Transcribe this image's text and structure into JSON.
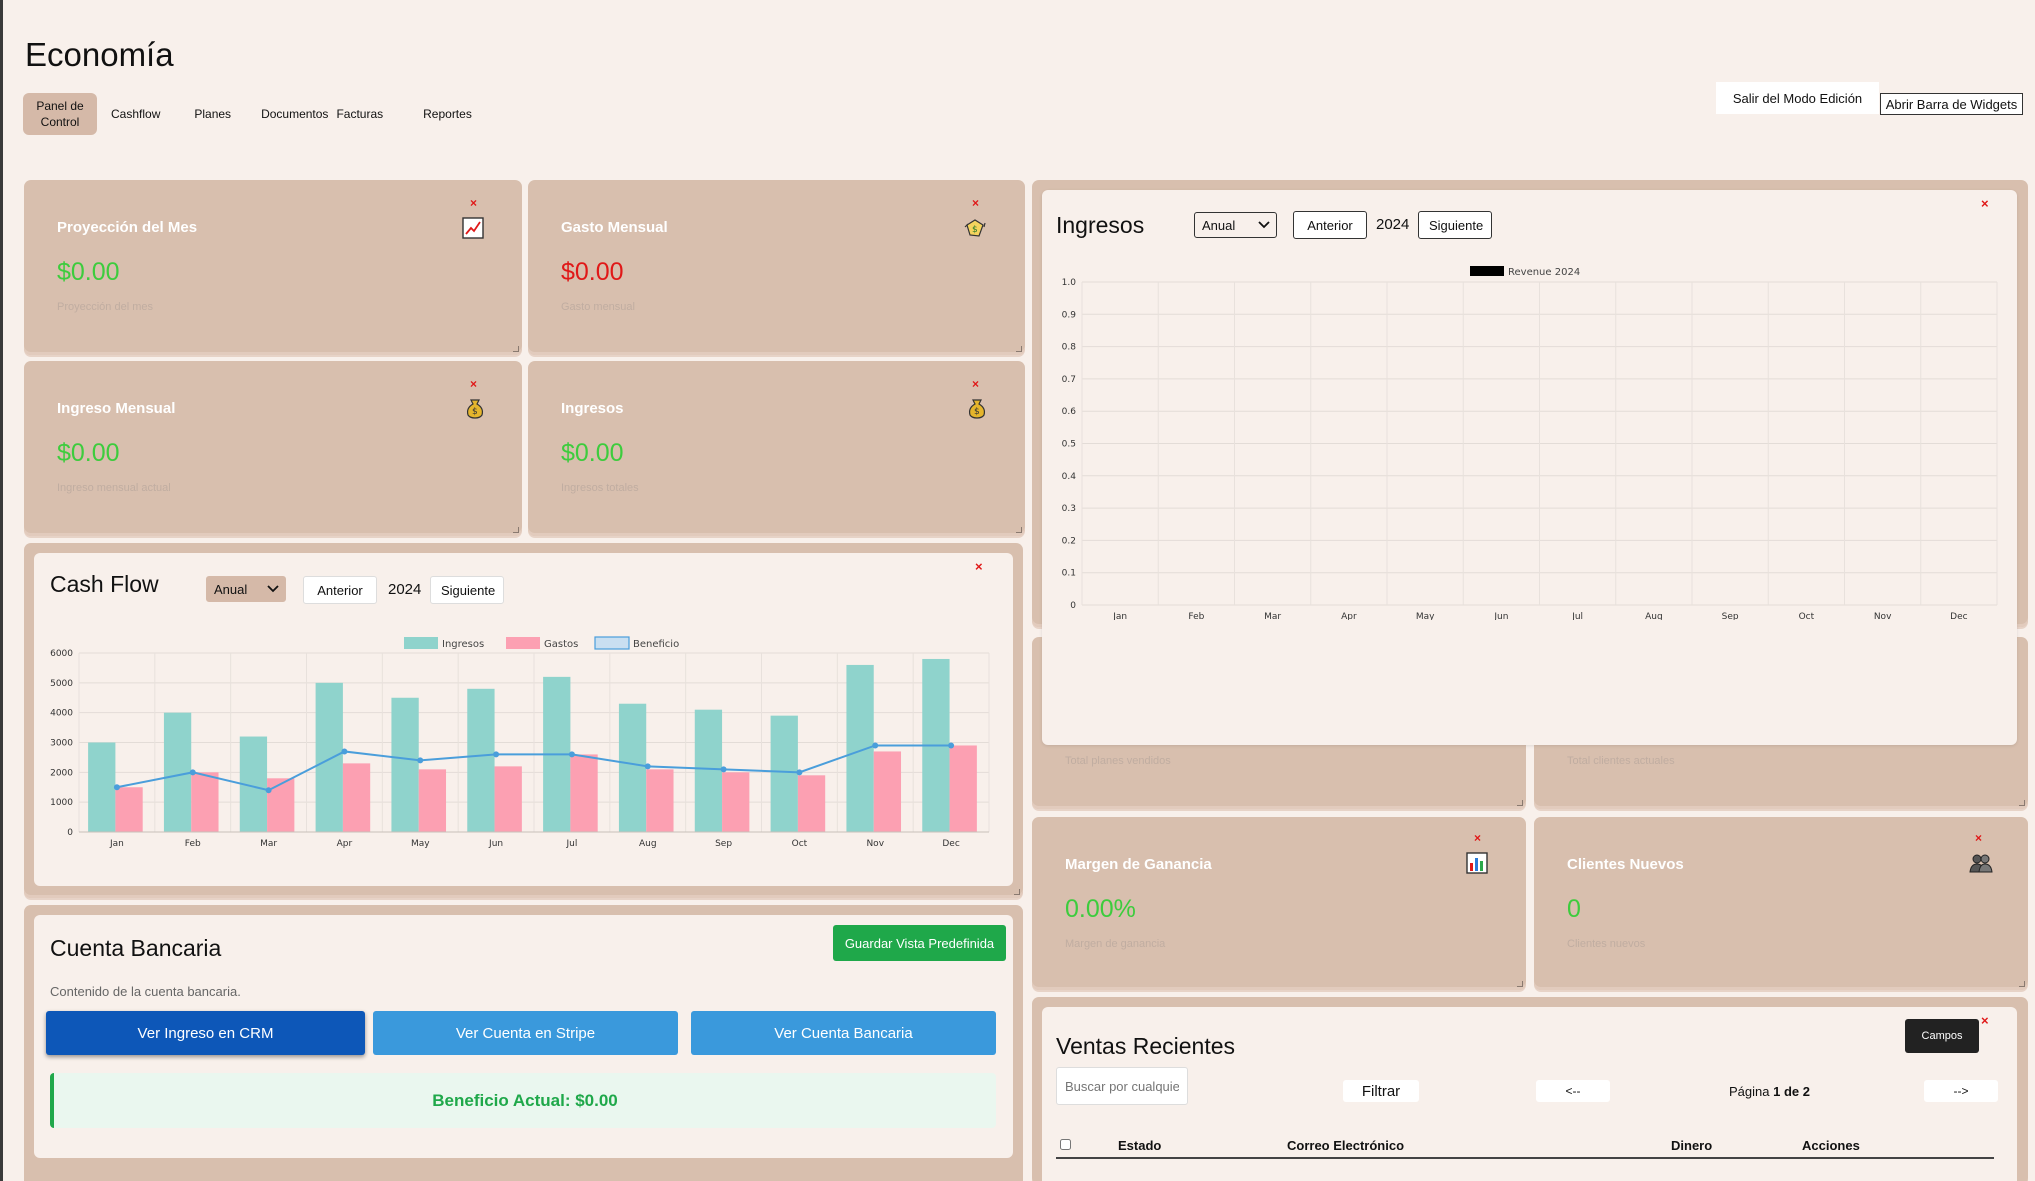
{
  "page": {
    "title": "Economía"
  },
  "nav": {
    "items": [
      {
        "label": "Panel de Control",
        "active": true
      },
      {
        "label": "Cashflow"
      },
      {
        "label": "Planes"
      },
      {
        "label": "Documentos"
      },
      {
        "label": "Facturas"
      },
      {
        "label": "Reportes"
      }
    ]
  },
  "toolbar": {
    "exit_edit": "Salir del Modo Edición",
    "open_widgets": "Abrir Barra de Widgets"
  },
  "kpis": {
    "projection": {
      "title": "Proyección del Mes",
      "value": "$0.00",
      "sub": "Proyección del mes",
      "icon": "chart-up-icon"
    },
    "spending": {
      "title": "Gasto Mensual",
      "value": "$0.00",
      "sub": "Gasto mensual",
      "icon": "money-wings-icon"
    },
    "monthly_income": {
      "title": "Ingreso Mensual",
      "value": "$0.00",
      "sub": "Ingreso mensual actual",
      "icon": "money-bag-icon"
    },
    "income": {
      "title": "Ingresos",
      "value": "$0.00",
      "sub": "Ingresos totales",
      "icon": "money-bag-icon"
    },
    "plans": {
      "sub": "Total planes vendidos"
    },
    "clients": {
      "sub": "Total clientes actuales"
    },
    "margin": {
      "title": "Margen de Ganancia",
      "value": "0.00%",
      "sub": "Margen de ganancia",
      "icon": "bar-chart-icon"
    },
    "new_clients": {
      "title": "Clientes Nuevos",
      "value": "0",
      "sub": "Clientes nuevos",
      "icon": "users-icon"
    }
  },
  "close_symbol": "×",
  "cashflow": {
    "title": "Cash Flow",
    "period": "Anual",
    "prev": "Anterior",
    "year": "2024",
    "next": "Siguiente"
  },
  "ingresos_panel": {
    "title": "Ingresos",
    "period": "Anual",
    "prev": "Anterior",
    "year": "2024",
    "next": "Siguiente"
  },
  "bank": {
    "title": "Cuenta Bancaria",
    "desc": "Contenido de la cuenta bancaria.",
    "save": "Guardar Vista Predefinida",
    "btn_crm": "Ver Ingreso en CRM",
    "btn_stripe": "Ver Cuenta en Stripe",
    "btn_bank": "Ver Cuenta Bancaria",
    "profit": "Beneficio Actual: $0.00"
  },
  "sales": {
    "title": "Ventas Recientes",
    "fields": "Campos",
    "search_placeholder": "Buscar por cualquier campo",
    "filter": "Filtrar",
    "prev": "<--",
    "next": "-->",
    "page_prefix": "Página ",
    "page_current": "1",
    "page_mid": " de ",
    "page_total": "2",
    "columns": [
      "Estado",
      "Correo Electrónico",
      "Dinero",
      "Acciones"
    ]
  },
  "colors": {
    "income": "#8fd3cc",
    "expense": "#fca0b2",
    "profit": "#4a9edb",
    "green": "#3dcc3d",
    "red": "#e01818"
  },
  "chart_data": [
    {
      "type": "bar",
      "categories": [
        "Jan",
        "Feb",
        "Mar",
        "Apr",
        "May",
        "Jun",
        "Jul",
        "Aug",
        "Sep",
        "Oct",
        "Nov",
        "Dec"
      ],
      "series": [
        {
          "name": "Ingresos",
          "type": "bar",
          "values": [
            3000,
            4000,
            3200,
            5000,
            4500,
            4800,
            5200,
            4300,
            4100,
            3900,
            5600,
            5800
          ]
        },
        {
          "name": "Gastos",
          "type": "bar",
          "values": [
            1500,
            2000,
            1800,
            2300,
            2100,
            2200,
            2600,
            2100,
            2000,
            1900,
            2700,
            2900
          ]
        },
        {
          "name": "Beneficio",
          "type": "line",
          "values": [
            1500,
            2000,
            1400,
            2700,
            2400,
            2600,
            2600,
            2200,
            2100,
            2000,
            2900,
            2900
          ]
        }
      ],
      "ylim": [
        0,
        6000
      ],
      "yticks": [
        0,
        1000,
        2000,
        3000,
        4000,
        5000,
        6000
      ],
      "grid": true,
      "legend": "top"
    },
    {
      "type": "line",
      "categories": [
        "Jan",
        "Feb",
        "Mar",
        "Apr",
        "May",
        "Jun",
        "Jul",
        "Aug",
        "Sep",
        "Oct",
        "Nov",
        "Dec"
      ],
      "series": [
        {
          "name": "Revenue 2024",
          "values": []
        }
      ],
      "ylim": [
        0,
        1.0
      ],
      "yticks": [
        "0",
        "0.1",
        "0.2",
        "0.3",
        "0.4",
        "0.5",
        "0.6",
        "0.7",
        "0.8",
        "0.9",
        "1.0"
      ],
      "grid": true,
      "legend": "top"
    }
  ]
}
